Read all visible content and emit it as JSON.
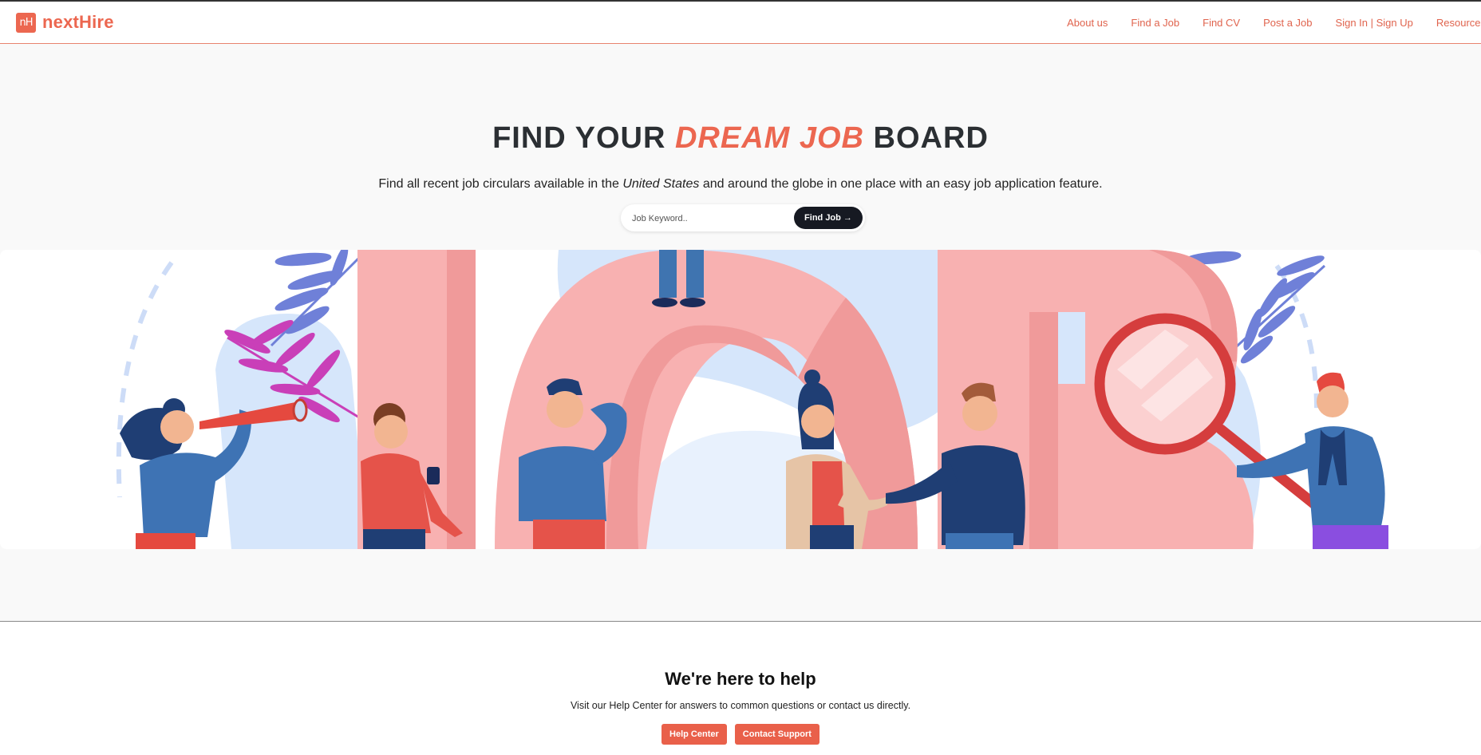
{
  "brand": {
    "logo_mark": "nH",
    "name": "nextHire",
    "accent_color": "#ec6750"
  },
  "nav": {
    "items": [
      {
        "label": "About us"
      },
      {
        "label": "Find a Job"
      },
      {
        "label": "Find CV"
      },
      {
        "label": "Post a Job"
      },
      {
        "label": "Sign In | Sign Up"
      },
      {
        "label": "Resources"
      }
    ]
  },
  "hero": {
    "title_pre": "FIND YOUR ",
    "title_accent": "DREAM JOB",
    "title_post": " BOARD",
    "subtitle_pre": "Find all recent job circulars available in the ",
    "subtitle_em": "United States",
    "subtitle_post": " and around the globe in one place with an easy job application feature.",
    "search_placeholder": "Job Keyword..",
    "search_button": "Find Job →"
  },
  "illustration": {
    "icon": "job-search-people-illustration",
    "letters_color": "#f8b1b1",
    "shadow_color": "#f09a9a",
    "blob_color": "#d6e6fb",
    "leaf_blue": "#6f80d8",
    "leaf_magenta": "#c93fb8"
  },
  "help": {
    "title": "We're here to help",
    "text": "Visit our Help Center for answers to common questions or contact us directly.",
    "help_center_button": "Help Center",
    "contact_button": "Contact Support",
    "button_color": "#e9604a"
  }
}
